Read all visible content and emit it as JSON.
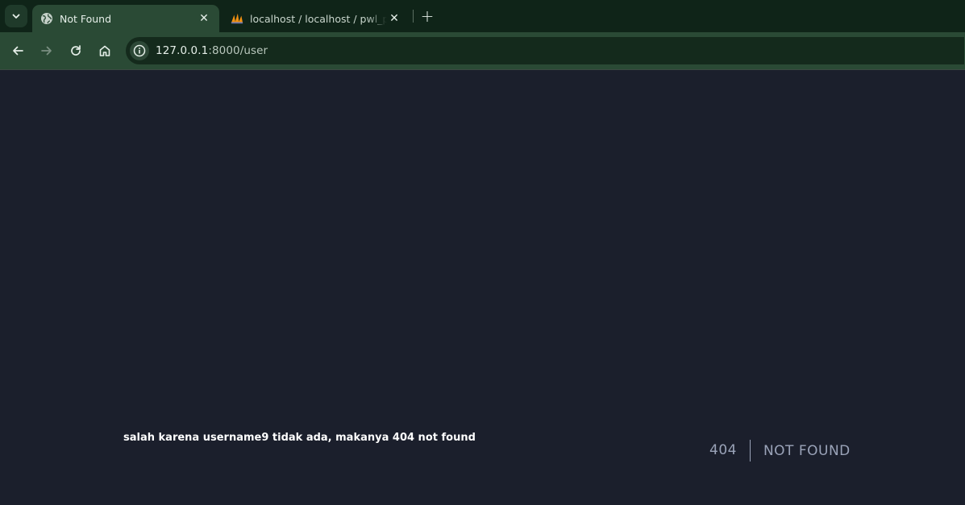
{
  "tabs": [
    {
      "title": "Not Found",
      "active": true,
      "favicon": "globe-icon"
    },
    {
      "title": "localhost / localhost / pwl_pos / ",
      "active": false,
      "favicon": "phpmyadmin-icon"
    }
  ],
  "toolbar": {
    "url_host": "127.0.0.1",
    "url_rest": ":8000/user"
  },
  "page": {
    "note": "salah karena username9 tidak ada, makanya 404 not found",
    "error_code": "404",
    "error_message": "NOT FOUND"
  },
  "colors": {
    "tabstrip_bg": "#0f2418",
    "toolbar_bg": "#2a4a35",
    "page_bg": "#1b1f2c",
    "error_text": "#9aa3b8"
  }
}
